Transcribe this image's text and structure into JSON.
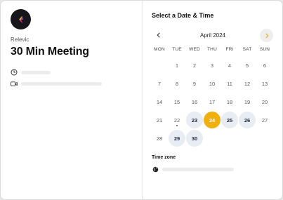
{
  "host": {
    "name": "Relevic"
  },
  "event": {
    "title": "30 Min Meeting"
  },
  "meta": {
    "duration_icon": "clock-icon",
    "location_icon": "video-camera-icon"
  },
  "picker": {
    "title": "Select a Date & Time",
    "month": "April 2024",
    "prev_icon": "chevron-left-icon",
    "next_icon": "chevron-right-icon",
    "weekdays": [
      "MON",
      "TUE",
      "WED",
      "THU",
      "FRI",
      "SAT",
      "SUN"
    ],
    "weeks": [
      [
        {
          "d": "1",
          "state": "disabled"
        },
        {
          "d": "2",
          "state": "disabled"
        },
        {
          "d": "3",
          "state": "disabled"
        },
        {
          "d": "4",
          "state": "disabled"
        },
        {
          "d": "5",
          "state": "disabled"
        },
        {
          "d": "6",
          "state": "disabled"
        }
      ],
      [
        {
          "d": "7",
          "state": "disabled"
        },
        {
          "d": "8",
          "state": "disabled"
        },
        {
          "d": "9",
          "state": "disabled"
        },
        {
          "d": "10",
          "state": "disabled"
        },
        {
          "d": "11",
          "state": "disabled"
        },
        {
          "d": "12",
          "state": "disabled"
        },
        {
          "d": "13",
          "state": "disabled"
        }
      ],
      [
        {
          "d": "14",
          "state": "disabled"
        },
        {
          "d": "15",
          "state": "disabled"
        },
        {
          "d": "16",
          "state": "disabled"
        },
        {
          "d": "17",
          "state": "disabled"
        },
        {
          "d": "18",
          "state": "disabled"
        },
        {
          "d": "19",
          "state": "disabled"
        },
        {
          "d": "20",
          "state": "disabled"
        }
      ],
      [
        {
          "d": "21",
          "state": "disabled"
        },
        {
          "d": "22",
          "state": "today"
        },
        {
          "d": "23",
          "state": "available"
        },
        {
          "d": "24",
          "state": "selected"
        },
        {
          "d": "25",
          "state": "available"
        },
        {
          "d": "26",
          "state": "available"
        },
        {
          "d": "27",
          "state": "disabled"
        }
      ],
      [
        {
          "d": "28",
          "state": "disabled"
        },
        {
          "d": "29",
          "state": "available"
        },
        {
          "d": "30",
          "state": "available"
        }
      ]
    ]
  },
  "timezone": {
    "label": "Time zone",
    "icon": "globe-icon"
  },
  "colors": {
    "selected": "#f0b00f",
    "available_bg": "#e8ecf3",
    "next_arrow": "#f0b00f"
  }
}
